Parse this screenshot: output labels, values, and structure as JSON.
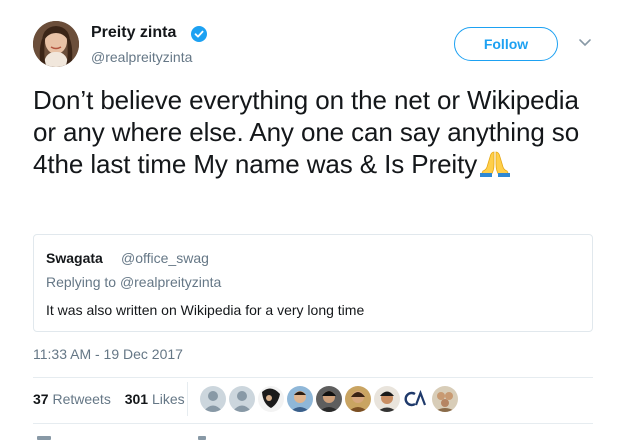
{
  "author": {
    "display_name": "Preity zinta",
    "handle": "@realpreityzinta",
    "verified": true
  },
  "follow_label": "Follow",
  "tweet_text": "Don’t believe everything on the net or Wikipedia or any where else. Any one can say anything so 4the last time My name was & Is Preity",
  "emoji": "pray-icon",
  "quoted_tweet": {
    "name": "Swagata",
    "handle": "@office_swag",
    "replying_prefix": "Replying to ",
    "replying_to": "@realpreityzinta",
    "text": "It was also written on Wikipedia for a very long time"
  },
  "timestamp": "11:33 AM - 19 Dec 2017",
  "stats": {
    "retweets_count": "37",
    "retweets_label": " Retweets",
    "likes_count": "301",
    "likes_label": " Likes"
  },
  "likers": [
    "default-avatar-1",
    "default-avatar-2",
    "user-avatar-3",
    "user-avatar-4",
    "user-avatar-5",
    "user-avatar-6",
    "user-avatar-7",
    "ca-logo-avatar",
    "user-avatar-9"
  ],
  "colors": {
    "accent": "#1da1f2",
    "text": "#14171a",
    "secondary": "#657786",
    "border": "#e1e8ed"
  }
}
